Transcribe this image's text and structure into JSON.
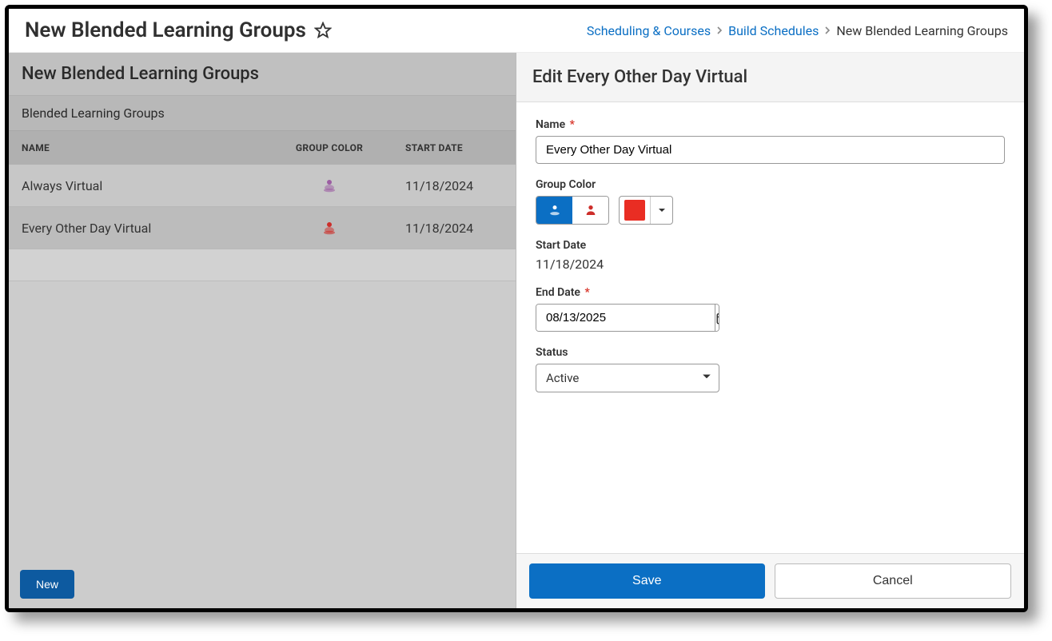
{
  "header": {
    "title": "New Blended Learning Groups",
    "star_icon": "star-outline-icon"
  },
  "breadcrumb": {
    "items": [
      {
        "label": "Scheduling & Courses",
        "link": true
      },
      {
        "label": "Build Schedules",
        "link": true
      },
      {
        "label": "New Blended Learning Groups",
        "link": false
      }
    ]
  },
  "left_panel": {
    "title": "New Blended Learning Groups",
    "subtitle": "Blended Learning Groups",
    "columns": {
      "name": "NAME",
      "color": "GROUP COLOR",
      "date": "START DATE"
    },
    "rows": [
      {
        "name": "Always Virtual",
        "icon_color": "#9c5ea3",
        "date": "11/18/2024"
      },
      {
        "name": "Every Other Day Virtual",
        "icon_color": "#cd2e2a",
        "date": "11/18/2024"
      }
    ],
    "new_button": "New"
  },
  "right_panel": {
    "title": "Edit Every Other Day Virtual",
    "name": {
      "label": "Name",
      "required": true,
      "value": "Every Other Day Virtual"
    },
    "group_color": {
      "label": "Group Color",
      "toggle_icons": [
        "person-pin-icon",
        "person-icon"
      ],
      "swatch_color": "#e92d23"
    },
    "start_date": {
      "label": "Start Date",
      "value": "11/18/2024"
    },
    "end_date": {
      "label": "End Date",
      "required": true,
      "value": "08/13/2025"
    },
    "status": {
      "label": "Status",
      "value": "Active"
    },
    "footer": {
      "save": "Save",
      "cancel": "Cancel"
    }
  }
}
